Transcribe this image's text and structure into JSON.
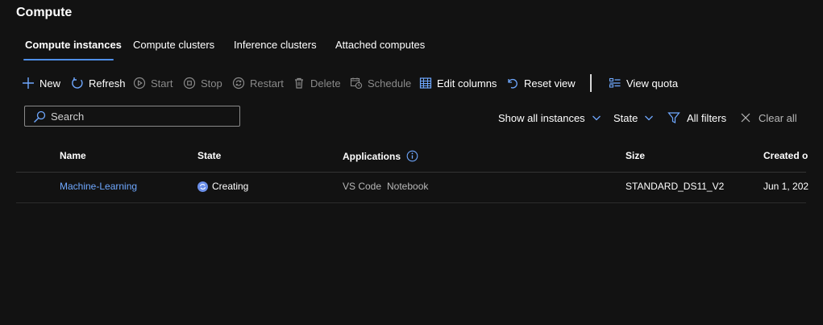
{
  "page": {
    "title": "Compute"
  },
  "tabs": [
    {
      "label": "Compute instances",
      "active": true
    },
    {
      "label": "Compute clusters"
    },
    {
      "label": "Inference clusters"
    },
    {
      "label": "Attached computes"
    }
  ],
  "toolbar": {
    "new": "New",
    "refresh": "Refresh",
    "start": "Start",
    "stop": "Stop",
    "restart": "Restart",
    "delete": "Delete",
    "schedule": "Schedule",
    "edit_columns": "Edit columns",
    "reset_view": "Reset view",
    "view_quota": "View quota"
  },
  "search": {
    "placeholder": "Search",
    "value": ""
  },
  "filters": {
    "show_all": "Show all instances",
    "state": "State",
    "all_filters": "All filters",
    "clear_all": "Clear all"
  },
  "table": {
    "columns": {
      "name": "Name",
      "state": "State",
      "applications": "Applications",
      "size": "Size",
      "created": "Created o"
    },
    "rows": [
      {
        "name": "Machine-Learning",
        "state": "Creating",
        "app1": "VS Code",
        "app2": "Notebook",
        "size": "STANDARD_DS11_V2",
        "created": "Jun 1, 202"
      }
    ]
  },
  "colors": {
    "accent": "#4f8fe8",
    "link": "#6fa8ff",
    "background": "#121212",
    "disabled": "#8a8a8a"
  }
}
